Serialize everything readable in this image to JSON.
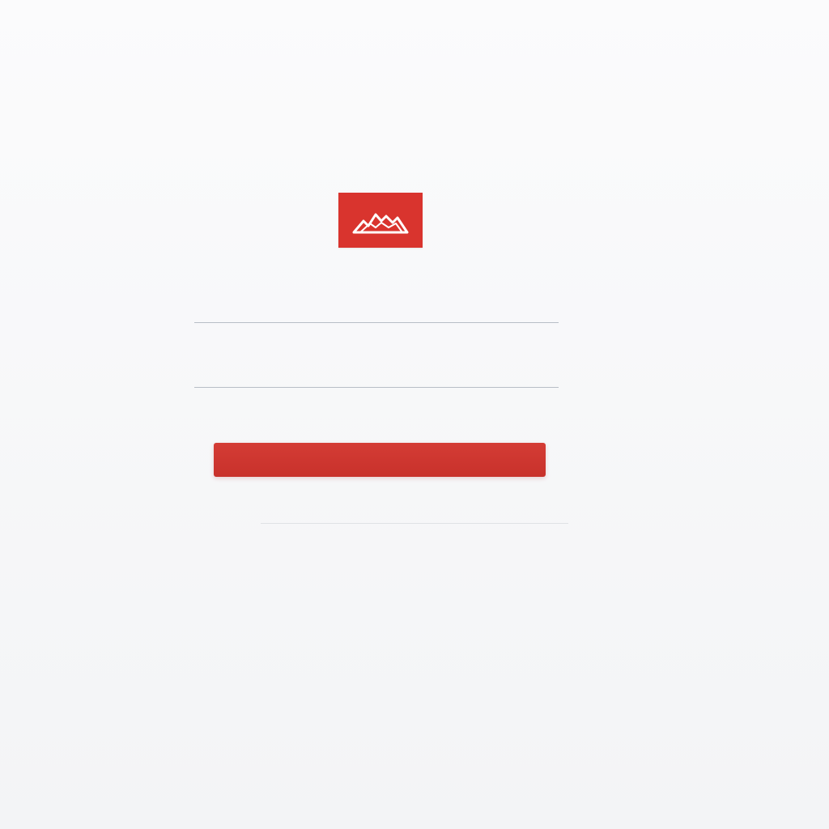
{
  "header": {
    "kicker": "",
    "title": "",
    "description": [
      "",
      ""
    ],
    "brand": ""
  },
  "logo": {
    "icon": "mountain-logo-icon",
    "background": "#d9342e"
  },
  "form": {
    "heading": "",
    "username": {
      "label": "",
      "value": ""
    },
    "password": {
      "label": "",
      "value": ""
    },
    "submit_label": ""
  },
  "colors": {
    "accent": "#d9342e",
    "text": "#4a4a4a",
    "muted": "#8a8f96"
  }
}
